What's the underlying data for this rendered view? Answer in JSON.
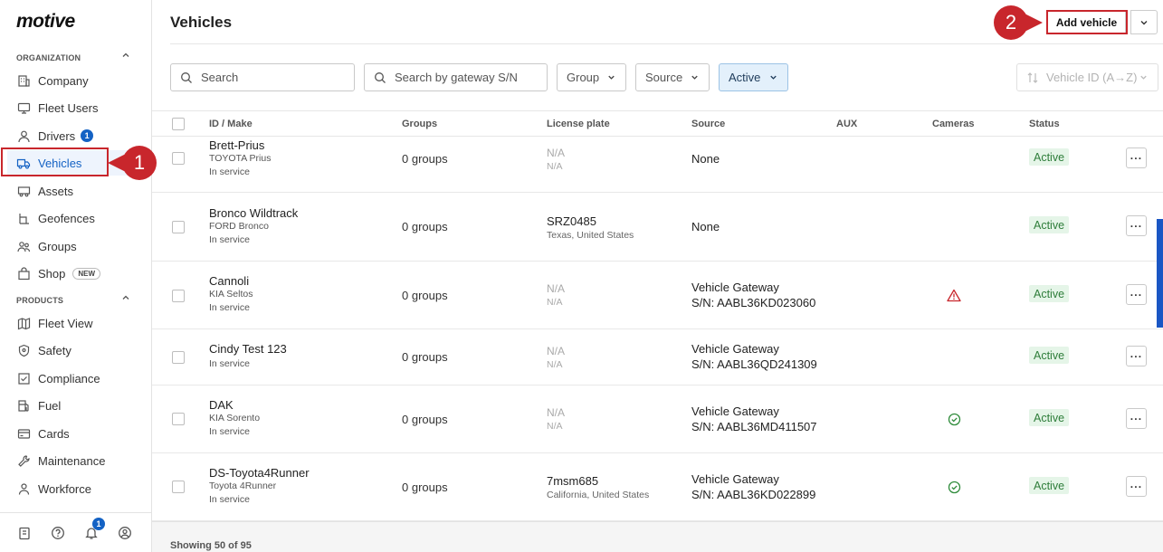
{
  "brand": {
    "logo": "motive"
  },
  "sidebar": {
    "organization_label": "ORGANIZATION",
    "products_label": "PRODUCTS",
    "org_items": [
      {
        "label": "Company",
        "icon": "building-icon"
      },
      {
        "label": "Fleet Users",
        "icon": "monitor-icon"
      },
      {
        "label": "Drivers",
        "icon": "person-icon",
        "badge": "1"
      },
      {
        "label": "Vehicles",
        "icon": "truck-icon",
        "active": true
      },
      {
        "label": "Assets",
        "icon": "trailer-icon"
      },
      {
        "label": "Geofences",
        "icon": "geofence-icon"
      },
      {
        "label": "Groups",
        "icon": "groups-icon"
      },
      {
        "label": "Shop",
        "icon": "bag-icon",
        "badge": "NEW"
      }
    ],
    "product_items": [
      {
        "label": "Fleet View",
        "icon": "map-icon"
      },
      {
        "label": "Safety",
        "icon": "shield-icon"
      },
      {
        "label": "Compliance",
        "icon": "compliance-icon"
      },
      {
        "label": "Fuel",
        "icon": "fuel-icon"
      },
      {
        "label": "Cards",
        "icon": "card-icon"
      },
      {
        "label": "Maintenance",
        "icon": "wrench-icon"
      },
      {
        "label": "Workforce",
        "icon": "workforce-icon"
      }
    ],
    "footer": {
      "notification_count": "1"
    }
  },
  "callouts": {
    "one": "1",
    "two": "2"
  },
  "header": {
    "title": "Vehicles",
    "add_label": "Add vehicle"
  },
  "filters": {
    "search_placeholder": "Search",
    "gateway_placeholder": "Search by gateway S/N",
    "group_label": "Group",
    "source_label": "Source",
    "status_label": "Active",
    "sort_label": "Vehicle ID (A→Z)"
  },
  "table": {
    "headers": [
      "ID / Make",
      "Groups",
      "License plate",
      "Source",
      "AUX",
      "Cameras",
      "Status"
    ],
    "rows": [
      {
        "name": "Brett-Prius",
        "make": "TOYOTA Prius",
        "service": "In service",
        "groups": "0 groups",
        "plate": "N/A",
        "plate_sub": "N/A",
        "source": "None",
        "source_sn": "",
        "camera": "",
        "status": "Active"
      },
      {
        "name": "Bronco Wildtrack",
        "make": "FORD Bronco",
        "service": "In service",
        "groups": "0 groups",
        "plate": "SRZ0485",
        "plate_sub": "Texas, United States",
        "source": "None",
        "source_sn": "",
        "camera": "",
        "status": "Active"
      },
      {
        "name": "Cannoli",
        "make": "KIA Seltos",
        "service": "In service",
        "groups": "0 groups",
        "plate": "N/A",
        "plate_sub": "N/A",
        "source": "Vehicle Gateway",
        "source_sn": "S/N: AABL36KD023060",
        "camera": "warning",
        "status": "Active"
      },
      {
        "name": "Cindy Test 123",
        "make": "",
        "service": "In service",
        "groups": "0 groups",
        "plate": "N/A",
        "plate_sub": "N/A",
        "source": "Vehicle Gateway",
        "source_sn": "S/N: AABL36QD241309",
        "camera": "",
        "status": "Active"
      },
      {
        "name": "DAK",
        "make": "KIA Sorento",
        "service": "In service",
        "groups": "0 groups",
        "plate": "N/A",
        "plate_sub": "N/A",
        "source": "Vehicle Gateway",
        "source_sn": "S/N: AABL36MD411507",
        "camera": "ok",
        "status": "Active"
      },
      {
        "name": "DS-Toyota4Runner",
        "make": "Toyota 4Runner",
        "service": "In service",
        "groups": "0 groups",
        "plate": "7msm685",
        "plate_sub": "California, United States",
        "source": "Vehicle Gateway",
        "source_sn": "S/N: AABL36KD022899",
        "camera": "ok",
        "status": "Active"
      }
    ],
    "footer": "Showing 50 of 95"
  },
  "colors": {
    "accent": "#1462c4",
    "callout": "#c8262c",
    "status_bg": "#e5f5e8",
    "status_text": "#2e7d3a"
  }
}
